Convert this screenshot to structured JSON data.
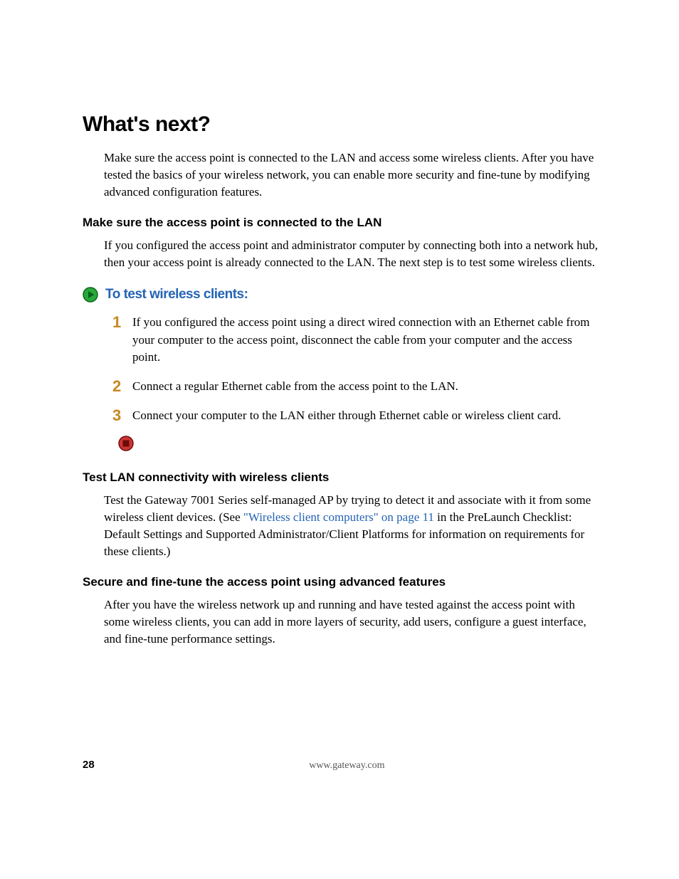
{
  "title": "What's next?",
  "intro": "Make sure the access point is connected to the LAN and access some wireless clients. After you have tested the basics of your wireless network, you can enable more security and fine-tune by modifying advanced configuration features.",
  "section1": {
    "heading": "Make sure the access point is connected to the LAN",
    "para": "If you configured the access point and administrator computer by connecting both into a network hub, then your access point is already connected to the LAN. The next step is to test some wireless clients."
  },
  "procedure": {
    "title": "To test wireless clients:",
    "icon": "play-icon",
    "steps": [
      "If you configured the access point using a direct wired connection with an Ethernet cable from your computer to the access point, disconnect the cable from your computer and the access point.",
      "Connect a regular Ethernet cable from the access point to the LAN.",
      "Connect your computer to the LAN either through Ethernet cable or wireless client card."
    ],
    "end_icon": "stop-icon"
  },
  "section2": {
    "heading": "Test LAN connectivity with wireless clients",
    "para_pre": "Test the Gateway 7001 Series self-managed AP by trying to detect it and associate with it from some wireless client devices. (See ",
    "link_text": "\"Wireless client computers\" on page 11",
    "para_post": " in the PreLaunch Checklist: Default Settings and Supported Administrator/Client Platforms for information on requirements for these clients.)"
  },
  "section3": {
    "heading": "Secure and fine-tune the access point using advanced features",
    "para": "After you have the wireless network up and running and have tested against the access point with some wireless clients, you can add in more layers of security, add users, configure a guest interface, and fine-tune performance settings."
  },
  "footer": {
    "page_number": "28",
    "url": "www.gateway.com"
  }
}
